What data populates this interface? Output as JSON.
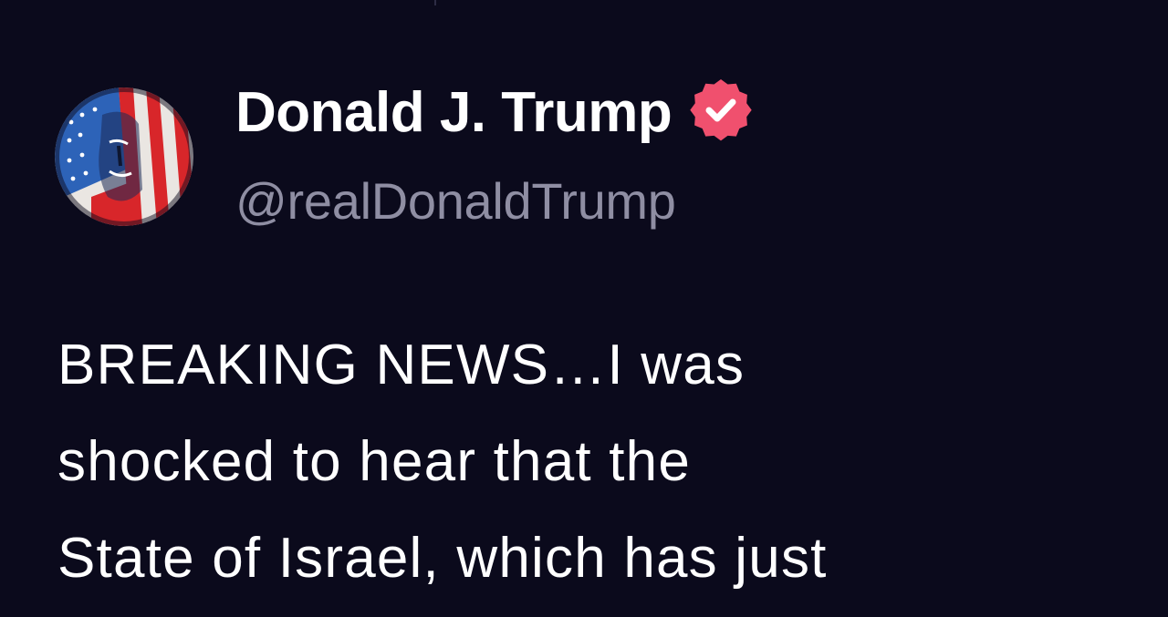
{
  "post": {
    "author": {
      "display_name": "Donald J. Trump",
      "handle": "@realDonaldTrump",
      "avatar_icon": "flag-portrait-avatar",
      "verified_icon": "verified-badge-icon"
    },
    "body_lines": [
      "BREAKING NEWS…I was",
      "shocked to hear that the",
      "State of Israel, which has just"
    ]
  },
  "colors": {
    "background": "#0b0a1c",
    "text": "#ffffff",
    "handle": "#8f8ea3",
    "verified_badge": "#f0506e"
  }
}
